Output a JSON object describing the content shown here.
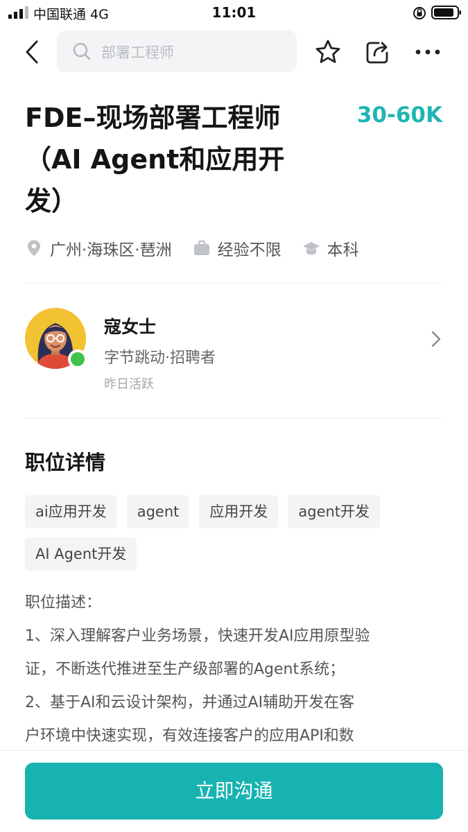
{
  "status_bar": {
    "carrier": "中国联通  4G",
    "time": "11:01",
    "icons": [
      "signal-icon",
      "rotation-lock-icon",
      "battery-icon"
    ]
  },
  "nav": {
    "search_placeholder": "部署工程师",
    "icons": [
      "back-icon",
      "search-icon",
      "star-icon",
      "share-icon",
      "more-icon"
    ]
  },
  "job": {
    "title": "FDE–现场部署工程师（AI Agent和应用开发）",
    "salary": "30-60K",
    "location": "广州·海珠区·琶洲",
    "experience": "经验不限",
    "education": "本科"
  },
  "recruiter": {
    "name": "寇女士",
    "company": "字节跳动·招聘者",
    "active": "昨日活跃"
  },
  "details": {
    "section_title": "职位详情",
    "tags": [
      "ai应用开发",
      "agent",
      "应用开发",
      "agent开发",
      "AI Agent开发"
    ],
    "description": [
      "职位描述：",
      "1、深入理解客户业务场景，快速开发AI应用原型验",
      "证，不断迭代推进至生产级部署的Agent系统；",
      "2、基于AI和云设计架构，并通过AI辅助开发在客",
      "户环境中快速实现，有效连接客户的应用API和数"
    ]
  },
  "cta": {
    "label": "立即沟通"
  },
  "colors": {
    "accent": "#16b3b1",
    "salary": "#1fb5b1"
  }
}
